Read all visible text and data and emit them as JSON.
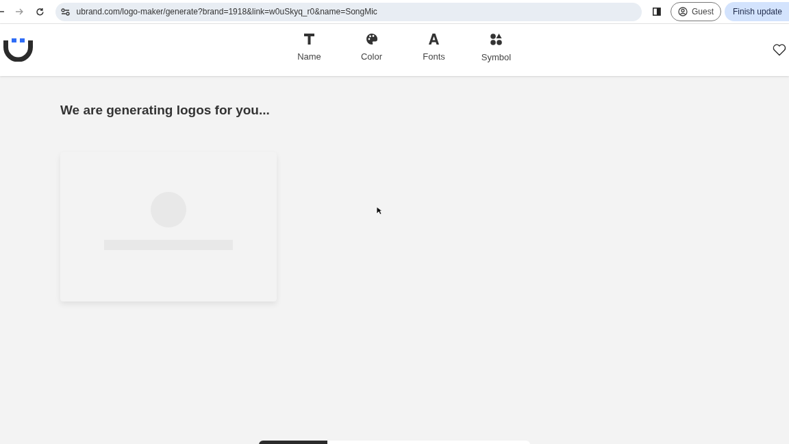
{
  "browser": {
    "url": "ubrand.com/logo-maker/generate?brand=1918&link=w0uSkyq_r0&name=SongMic",
    "profile": "Guest",
    "update_button": "Finish update"
  },
  "nav": [
    {
      "kind": "text",
      "label": "Name"
    },
    {
      "kind": "color",
      "label": "Color"
    },
    {
      "kind": "fonts",
      "label": "Fonts"
    },
    {
      "kind": "symbol",
      "label": "Symbol"
    }
  ],
  "heading": "We are generating logos for you..."
}
